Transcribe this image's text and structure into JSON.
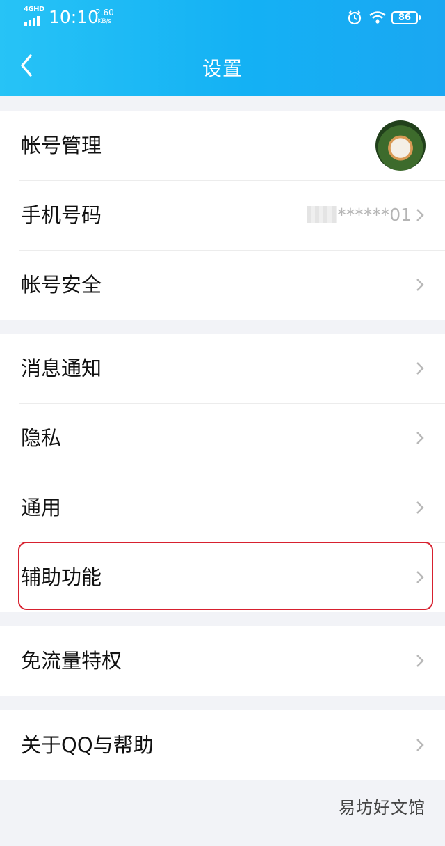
{
  "status_bar": {
    "network": "4GHD",
    "time": "10:10",
    "speed_value": "2.60",
    "speed_unit": "KB/s",
    "battery": "86",
    "icons": [
      "signal-icon",
      "alarm-icon",
      "wifi-icon",
      "battery-icon"
    ]
  },
  "header": {
    "title": "设置",
    "back_icon": "chevron-left-icon",
    "background": "#14b1f4"
  },
  "groups": [
    {
      "items": [
        {
          "label": "帐号管理",
          "trailing": "avatar"
        },
        {
          "label": "手机号码",
          "value": "******01"
        },
        {
          "label": "帐号安全"
        }
      ]
    },
    {
      "items": [
        {
          "label": "消息通知"
        },
        {
          "label": "隐私"
        },
        {
          "label": "通用"
        },
        {
          "label": "辅助功能",
          "highlighted": true
        }
      ]
    },
    {
      "items": [
        {
          "label": "免流量特权"
        }
      ]
    },
    {
      "items": [
        {
          "label": "关于QQ与帮助"
        }
      ]
    }
  ],
  "highlight_color": "#d7212f",
  "watermark": "易坊好文馆"
}
